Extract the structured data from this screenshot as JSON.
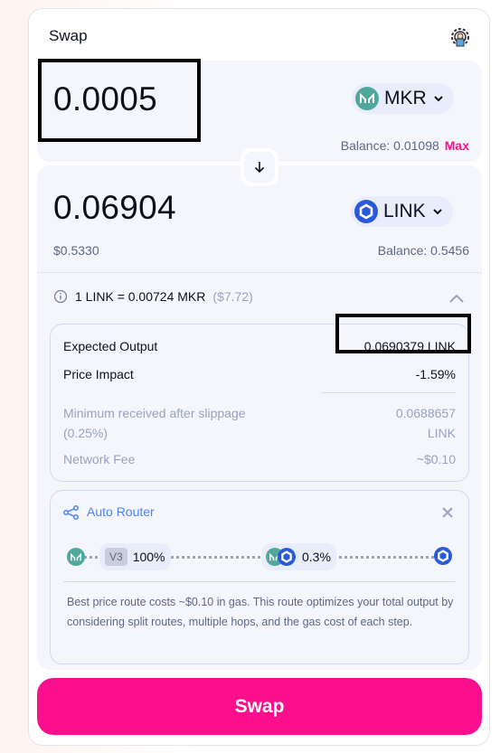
{
  "header": {
    "title": "Swap",
    "settings_icon": "gear-icon"
  },
  "input": {
    "amount": "0.0005",
    "token": "MKR",
    "balance_label": "Balance: 0.01098",
    "max_label": "Max"
  },
  "switch_icon": "arrow-down-icon",
  "output": {
    "amount": "0.06904",
    "usd_value": "$0.5330",
    "token": "LINK",
    "balance_label": "Balance: 0.5456"
  },
  "rate": {
    "text": "1 LINK = 0.00724 MKR",
    "usd": "($7.72)"
  },
  "details": {
    "expected_output_label": "Expected Output",
    "expected_output_value": "0.0690379 LINK",
    "price_impact_label": "Price Impact",
    "price_impact_value": "-1.59%",
    "min_received_label_line1": "Minimum received after slippage",
    "min_received_label_line2": "(0.25%)",
    "min_received_value_line1": "0.0688657",
    "min_received_value_line2": "LINK",
    "network_fee_label": "Network Fee",
    "network_fee_value": "~$0.10"
  },
  "router": {
    "title": "Auto Router",
    "pool_version": "V3",
    "split_1": "100%",
    "split_2": "0.3%",
    "description": "Best price route costs ~$0.10 in gas. This route optimizes your total output by considering split routes, multiple hops, and the gas cost of each step."
  },
  "swap_button": "Swap",
  "colors": {
    "accent_pink": "#fc0f8d",
    "router_blue": "#4c82fb",
    "mkr_teal": "#4fa89b",
    "link_blue": "#2a5ada"
  }
}
